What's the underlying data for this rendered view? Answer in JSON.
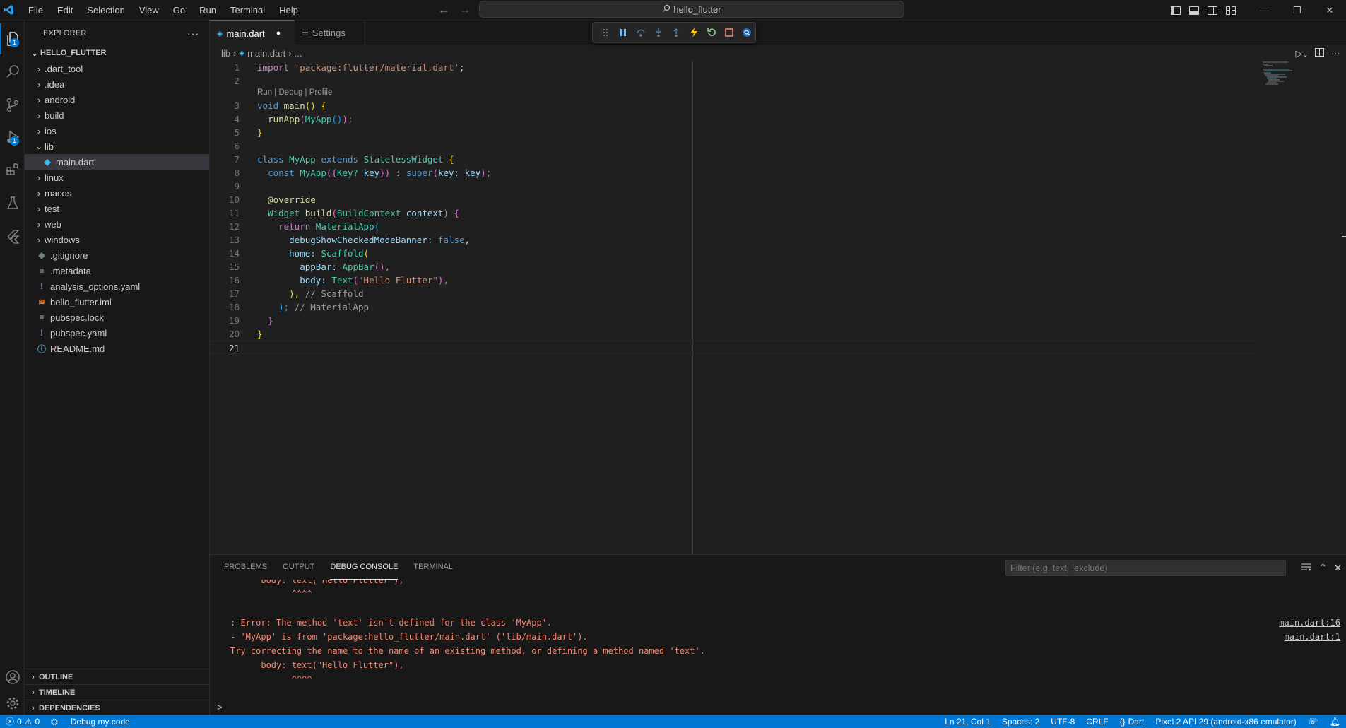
{
  "titlebar": {
    "menu": [
      "File",
      "Edit",
      "Selection",
      "View",
      "Go",
      "Run",
      "Terminal",
      "Help"
    ],
    "search_text": "hello_flutter",
    "window_controls": [
      "minimize-icon",
      "restore-icon",
      "close-icon"
    ]
  },
  "activity_bar": {
    "items": [
      "explorer-icon",
      "search-icon",
      "source-control-icon",
      "run-debug-icon",
      "extensions-icon",
      "testing-icon",
      "flutter-icon"
    ],
    "explorer_badge": "1",
    "debug_badge": "1",
    "bottom_items": [
      "account-icon",
      "settings-gear-icon"
    ]
  },
  "sidebar": {
    "title": "EXPLORER",
    "more": "···",
    "project": "HELLO_FLUTTER",
    "tree": [
      {
        "label": ".dart_tool",
        "kind": "folder"
      },
      {
        "label": ".idea",
        "kind": "folder"
      },
      {
        "label": "android",
        "kind": "folder"
      },
      {
        "label": "build",
        "kind": "folder"
      },
      {
        "label": "ios",
        "kind": "folder"
      },
      {
        "label": "lib",
        "kind": "folder-open"
      },
      {
        "label": "main.dart",
        "kind": "dart-file"
      },
      {
        "label": "linux",
        "kind": "folder"
      },
      {
        "label": "macos",
        "kind": "folder"
      },
      {
        "label": "test",
        "kind": "folder"
      },
      {
        "label": "web",
        "kind": "folder"
      },
      {
        "label": "windows",
        "kind": "folder"
      },
      {
        "label": ".gitignore",
        "kind": "git-file"
      },
      {
        "label": ".metadata",
        "kind": "text-file"
      },
      {
        "label": "analysis_options.yaml",
        "kind": "yaml-file"
      },
      {
        "label": "hello_flutter.iml",
        "kind": "xml-file"
      },
      {
        "label": "pubspec.lock",
        "kind": "text-file"
      },
      {
        "label": "pubspec.yaml",
        "kind": "yaml-file"
      },
      {
        "label": "README.md",
        "kind": "info-file"
      }
    ],
    "sections": [
      "OUTLINE",
      "TIMELINE",
      "DEPENDENCIES"
    ]
  },
  "tabs": [
    {
      "label": "main.dart",
      "dirty": "●"
    },
    {
      "label": "Settings"
    }
  ],
  "breadcrumb": {
    "folder": "lib",
    "file": "main.dart",
    "rest": "..."
  },
  "editor": {
    "codelens": "Run | Debug | Profile",
    "line_numbers": [
      "1",
      "2",
      "3",
      "4",
      "5",
      "6",
      "7",
      "8",
      "9",
      "10",
      "11",
      "12",
      "13",
      "14",
      "15",
      "16",
      "17",
      "18",
      "19",
      "20",
      "21"
    ],
    "l1_kw": "import",
    "l1_str": "'package:flutter/material.dart'",
    "l1_end": ";",
    "l3_kw": "void",
    "l3_fn": "main",
    "l3_br": "() {",
    "l4_fn": "runApp",
    "l4_open": "(",
    "l4_cls": "MyApp",
    "l4_call": "()",
    "l4_close": ");",
    "l5_br": "}",
    "l7_kw1": "class",
    "l7_cls1": "MyApp",
    "l7_kw2": "extends",
    "l7_cls2": "StatelessWidget",
    "l7_br": "{",
    "l8_kw": "const",
    "l8_cls": "MyApp",
    "l8_p1": "({",
    "l8_cls2": "Key?",
    "l8_var": "key",
    "l8_p2": "})",
    "l8_colon": ":",
    "l8_kw2": "super",
    "l8_p3": "(",
    "l8_var2": "key:",
    "l8_var3": "key",
    "l8_p4": ");",
    "l10_ann": "@override",
    "l11_cls": "Widget",
    "l11_fn": "build",
    "l11_p1": "(",
    "l11_cls2": "BuildContext",
    "l11_var": "context",
    "l11_p2": ") {",
    "l12_kw": "return",
    "l12_cls": "MaterialApp",
    "l12_p": "(",
    "l13_var": "debugShowCheckedModeBanner:",
    "l13_kw": "false",
    "l13_end": ",",
    "l14_var": "home:",
    "l14_cls": "Scaffold",
    "l14_p": "(",
    "l15_var": "appBar:",
    "l15_cls": "AppBar",
    "l15_p": "(),",
    "l16_var": "body:",
    "l16_cls": "Text",
    "l16_p1": "(",
    "l16_str": "\"Hello Flutter\"",
    "l16_p2": "),",
    "l17_p": "),",
    "l17_cmt": "// Scaffold",
    "l18_p": ");",
    "l18_cmt": "// MaterialApp",
    "l19_br": "}",
    "l20_br": "}"
  },
  "panel": {
    "tabs": [
      "PROBLEMS",
      "OUTPUT",
      "DEBUG CONSOLE",
      "TERMINAL"
    ],
    "filter_placeholder": "Filter (e.g. text, !exclude)",
    "output": [
      "      body: text(\"Hello Flutter\"),",
      "            ^^^^",
      "",
      ": Error: The method 'text' isn't defined for the class 'MyApp'.",
      "- 'MyApp' is from 'package:hello_flutter/main.dart' ('lib/main.dart').",
      "Try correcting the name to the name of an existing method, or defining a method named 'text'.",
      "      body: text(\"Hello Flutter\"),",
      "            ^^^^"
    ],
    "links": [
      "main.dart:16",
      "main.dart:1"
    ],
    "prompt": ">"
  },
  "statusbar": {
    "errors": "0",
    "warnings": "0",
    "debug": "Debug my code",
    "position": "Ln 21, Col 1",
    "spaces": "Spaces: 2",
    "encoding": "UTF-8",
    "eol": "CRLF",
    "language": "Dart",
    "device": "Pixel 2 API 29 (android-x86 emulator)"
  }
}
